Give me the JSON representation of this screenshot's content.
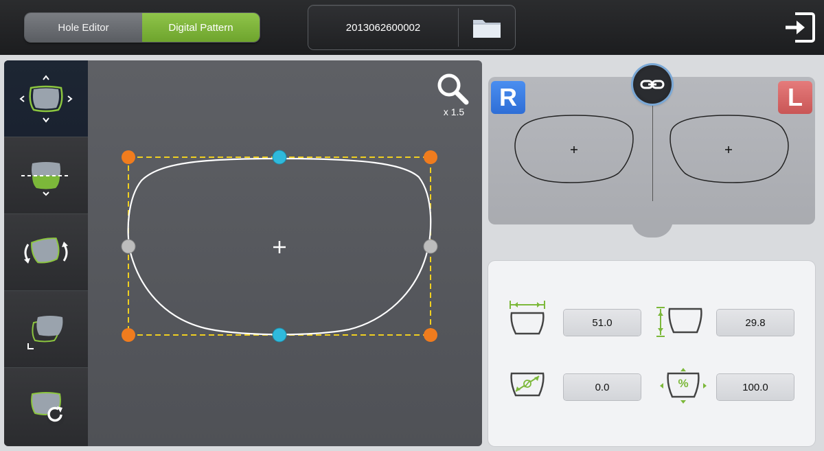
{
  "topbar": {
    "tabs": [
      {
        "label": "Hole Editor",
        "active": false
      },
      {
        "label": "Digital Pattern",
        "active": true
      }
    ],
    "job_id": "2013062600002",
    "folder_icon": "folder-icon",
    "exit_icon": "exit-icon"
  },
  "tools": [
    {
      "name": "move-shape-tool",
      "icon": "move-arrows-icon",
      "active": true
    },
    {
      "name": "split-shape-tool",
      "icon": "split-line-icon",
      "active": false
    },
    {
      "name": "rotate-shape-tool",
      "icon": "rotate-arrows-icon",
      "active": false
    },
    {
      "name": "skew-shape-tool",
      "icon": "corner-skew-icon",
      "active": false
    },
    {
      "name": "reset-shape-tool",
      "icon": "refresh-icon",
      "active": false
    }
  ],
  "canvas": {
    "zoom_label": "x 1.5",
    "zoom_icon": "magnifier-icon"
  },
  "preview": {
    "right_label": "R",
    "left_label": "L",
    "link_icon": "chain-link-icon"
  },
  "measurements": {
    "width": {
      "value": "51.0",
      "icon": "lens-width-icon"
    },
    "height": {
      "value": "29.8",
      "icon": "lens-height-icon"
    },
    "diameter": {
      "value": "0.0",
      "icon": "lens-diameter-icon"
    },
    "scale": {
      "value": "100.0",
      "icon": "lens-scale-percent-icon",
      "symbol": "%"
    }
  },
  "colors": {
    "accent_green": "#7cb83a",
    "handle_orange": "#f07c1e",
    "handle_cyan": "#2fb9dc",
    "handle_gray": "#bdbdbd",
    "bbox_yellow": "#f0d020"
  }
}
